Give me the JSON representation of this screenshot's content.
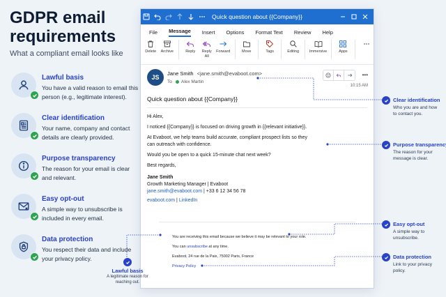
{
  "heading": {
    "title_line1": "GDPR email",
    "title_line2": "requirements",
    "subtitle": "What a compliant email looks like"
  },
  "requirements": [
    {
      "title": "Lawful basis",
      "desc": "You have a valid reason to email this person (e.g., legitimate interest).",
      "icon": "person-icon"
    },
    {
      "title": "Clear identification",
      "desc": "Your name, company and contact details are clearly provided.",
      "icon": "id-card-icon"
    },
    {
      "title": "Purpose transparency",
      "desc": "The reason for your email is clear and relevant.",
      "icon": "info-icon"
    },
    {
      "title": "Easy opt-out",
      "desc": "A simple way to unsubscribe is included in every email.",
      "icon": "envelope-x-icon"
    },
    {
      "title": "Data protection",
      "desc": "You respect their data and include your privacy policy.",
      "icon": "shield-lock-icon"
    }
  ],
  "window": {
    "title": "Quick question about {{Company}}",
    "menu": [
      "File",
      "Message",
      "Insert",
      "Options",
      "Format Text",
      "Review",
      "Help"
    ],
    "active_menu": "Message",
    "ribbon": [
      {
        "label": "Delete",
        "icon": "trash-icon"
      },
      {
        "label": "Archive",
        "icon": "archive-icon"
      },
      {
        "label": "Reply",
        "icon": "reply-icon"
      },
      {
        "label": "Reply All",
        "icon": "reply-all-icon"
      },
      {
        "label": "Forward",
        "icon": "forward-icon"
      },
      {
        "label": "Move",
        "icon": "folder-icon"
      },
      {
        "label": "Tags",
        "icon": "tag-icon"
      },
      {
        "label": "Editing",
        "icon": "search-icon"
      },
      {
        "label": "Immersive",
        "icon": "reader-icon"
      },
      {
        "label": "Apps",
        "icon": "apps-icon"
      }
    ]
  },
  "email": {
    "avatar_initials": "JS",
    "sender_name": "Jane Smith",
    "sender_email": "<jane.smith@evaboot.com>",
    "to_label": "To",
    "recipient": "Alex Martin",
    "time": "10:15 AM",
    "subject": "Quick question about {{Company}}",
    "greeting": "Hi Alex,",
    "para1": "I noticed {{Company}} is focused on driving growth in {{relevant initiative}}.",
    "para2": "At Evaboot, we help teams build accurate, compliant prospect lists so they can outreach with confidence.",
    "para3": "Would you be open to a quick 15-minute chat next week?",
    "closing": "Best regards,",
    "sig_name": "Jane Smith",
    "sig_role": "Growth Marketing Manager | Evaboot",
    "sig_email": "jane.smith@evaboot.com",
    "sig_phone": " | +33 6 12 34 56 78",
    "sig_site": "evaboot.com",
    "sig_sep": " | ",
    "sig_linkedin": "LinkedIn",
    "footer_reason": "You are receiving this email because we believe it may be relevant to your role.",
    "footer_unsub_pre": "You can ",
    "footer_unsub_link": "unsubscribe",
    "footer_unsub_post": " at any time.",
    "footer_address": "Evaboot, 24 rue de la Paix, 75002 Paris, France",
    "footer_privacy": "Privacy Policy"
  },
  "callouts": {
    "clear_id": {
      "title": "Clear identification",
      "desc": "Who you are and how to contact you."
    },
    "purpose": {
      "title": "Purpose transparency",
      "desc": "The reason for your message is clear."
    },
    "optout": {
      "title": "Easy opt-out",
      "desc": "A simple way to unsubscribe."
    },
    "data": {
      "title": "Data protection",
      "desc": "Link to your privacy policy."
    },
    "lawful": {
      "title": "Lawful basis",
      "desc": "A legitimate reason for reaching out."
    }
  },
  "colors": {
    "accent": "#2942c7",
    "titlebar": "#1f6fd0",
    "check_green": "#2ea44f"
  }
}
